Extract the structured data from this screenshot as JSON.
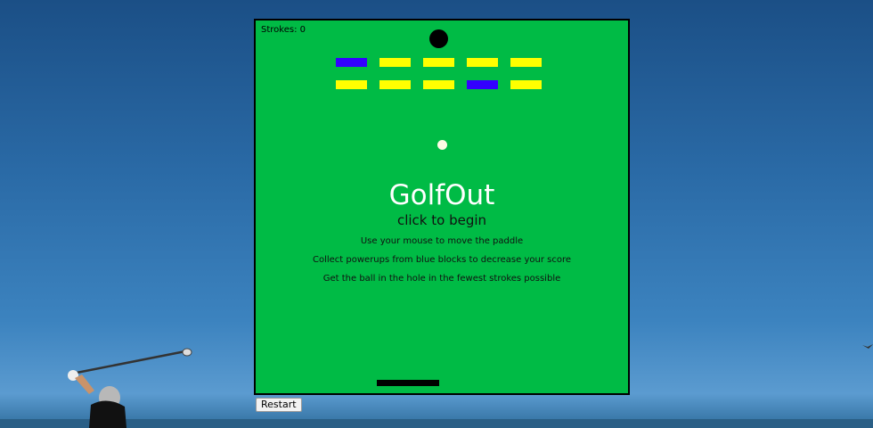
{
  "game": {
    "strokes_label": "Strokes: 0",
    "title": "GolfOut",
    "subtitle": "click to begin",
    "instructions": [
      "Use your mouse to move the paddle",
      "Collect powerups from blue blocks to decrease your score",
      "Get the ball in the hole in the fewest strokes possible"
    ],
    "brick_rows": [
      [
        "blue",
        "yellow",
        "yellow",
        "yellow",
        "yellow"
      ],
      [
        "yellow",
        "yellow",
        "yellow",
        "blue",
        "yellow"
      ]
    ],
    "colors": {
      "field": "#00bb45",
      "yellow": "#ffff00",
      "blue": "#3300ff",
      "hole": "#000000",
      "ball": "#fffbe6",
      "paddle": "#000000"
    }
  },
  "controls": {
    "restart_label": "Restart"
  }
}
